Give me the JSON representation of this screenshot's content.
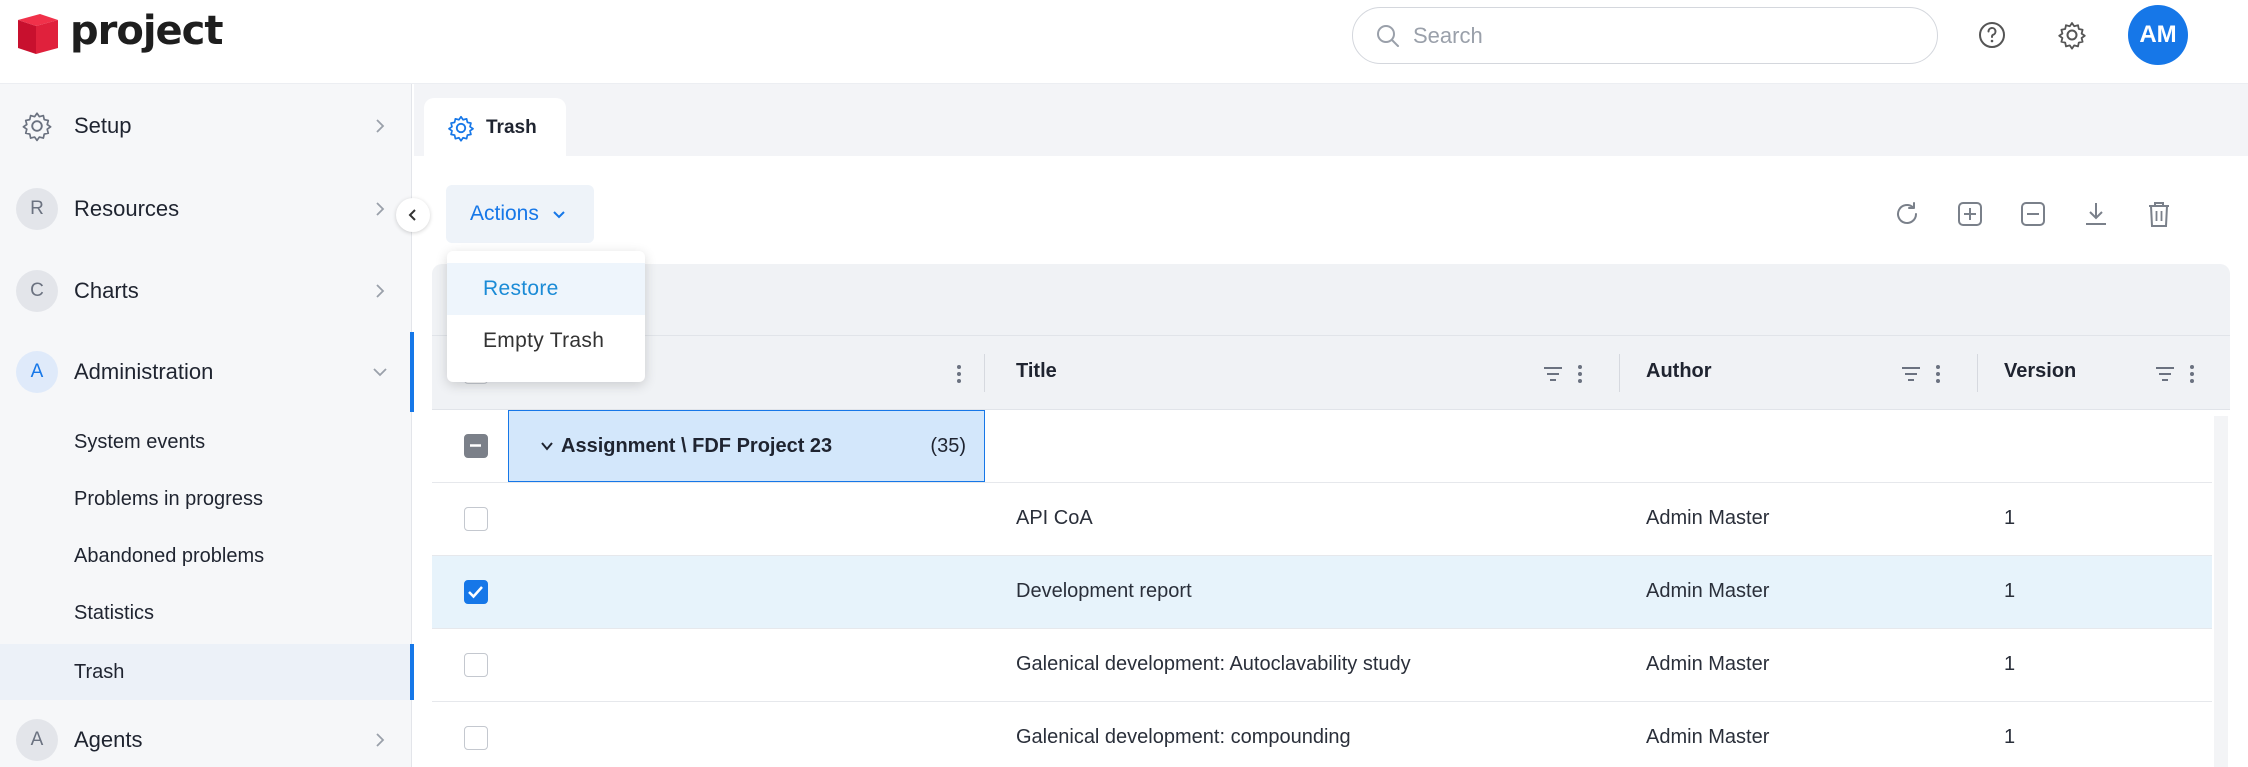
{
  "header": {
    "app_name": "project",
    "search_placeholder": "Search",
    "user_initials": "AM",
    "avatar_color": "#1677e8"
  },
  "sidebar": {
    "items": [
      {
        "label": "Setup",
        "icon": "gear-icon"
      },
      {
        "label": "Resources",
        "badge": "R"
      },
      {
        "label": "Charts",
        "badge": "C"
      },
      {
        "label": "Administration",
        "badge": "A",
        "expanded": true
      },
      {
        "label": "Agents",
        "badge": "A"
      }
    ],
    "subitems": [
      {
        "label": "System events"
      },
      {
        "label": "Problems in progress"
      },
      {
        "label": "Abandoned problems"
      },
      {
        "label": "Statistics"
      },
      {
        "label": "Trash",
        "active": true
      }
    ]
  },
  "tab": {
    "label": "Trash",
    "icon": "gear-icon"
  },
  "toolbar": {
    "actions_label": "Actions",
    "icons": [
      "refresh-icon",
      "expand-all-icon",
      "collapse-all-icon",
      "download-icon",
      "delete-icon"
    ]
  },
  "dropdown": {
    "items": [
      {
        "label": "Restore",
        "highlighted": true
      },
      {
        "label": "Empty Trash"
      }
    ]
  },
  "grid": {
    "columns": [
      "Title",
      "Author",
      "Version"
    ],
    "group": {
      "label": "Assignment \\ FDF Project 23",
      "count": "(35)"
    },
    "rows": [
      {
        "title": "API CoA",
        "author": "Admin Master",
        "version": "1",
        "checked": false
      },
      {
        "title": "Development report",
        "author": "Admin Master",
        "version": "1",
        "checked": true
      },
      {
        "title": "Galenical development: Autoclavability study",
        "author": "Admin Master",
        "version": "1",
        "checked": false
      },
      {
        "title": "Galenical development: compounding",
        "author": "Admin Master",
        "version": "1",
        "checked": false
      }
    ]
  },
  "colors": {
    "accent": "#1677e8",
    "selected_row": "#e7f3fb",
    "logo_red": "#d7263d"
  }
}
